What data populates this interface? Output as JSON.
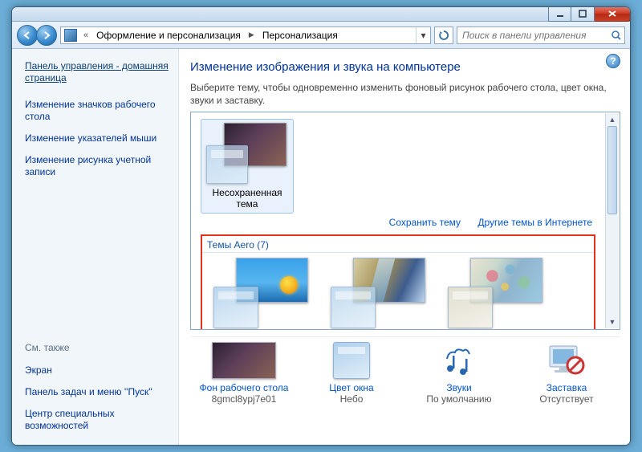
{
  "breadcrumb": {
    "seg1": "Оформление и персонализация",
    "seg2": "Персонализация"
  },
  "search": {
    "placeholder": "Поиск в панели управления"
  },
  "sidebar": {
    "home": "Панель управления - домашняя страница",
    "link1": "Изменение значков рабочего стола",
    "link2": "Изменение указателей мыши",
    "link3": "Изменение рисунка учетной записи",
    "seealso_head": "См. также",
    "seealso1": "Экран",
    "seealso2": "Панель задач и меню ''Пуск''",
    "seealso3": "Центр специальных возможностей"
  },
  "page": {
    "title": "Изменение изображения и звука на компьютере",
    "desc": "Выберите тему, чтобы одновременно изменить фоновый рисунок рабочего стола, цвет окна, звуки и заставку."
  },
  "themes": {
    "unsaved_label": "Несохраненная тема",
    "save_link": "Сохранить тему",
    "more_link": "Другие темы в Интернете",
    "aero_header": "Темы Aero (7)"
  },
  "bottom": {
    "bg_title": "Фон рабочего стола",
    "bg_sub": "8gmcl8ypj7e01",
    "color_title": "Цвет окна",
    "color_sub": "Небо",
    "sound_title": "Звуки",
    "sound_sub": "По умолчанию",
    "saver_title": "Заставка",
    "saver_sub": "Отсутствует"
  }
}
